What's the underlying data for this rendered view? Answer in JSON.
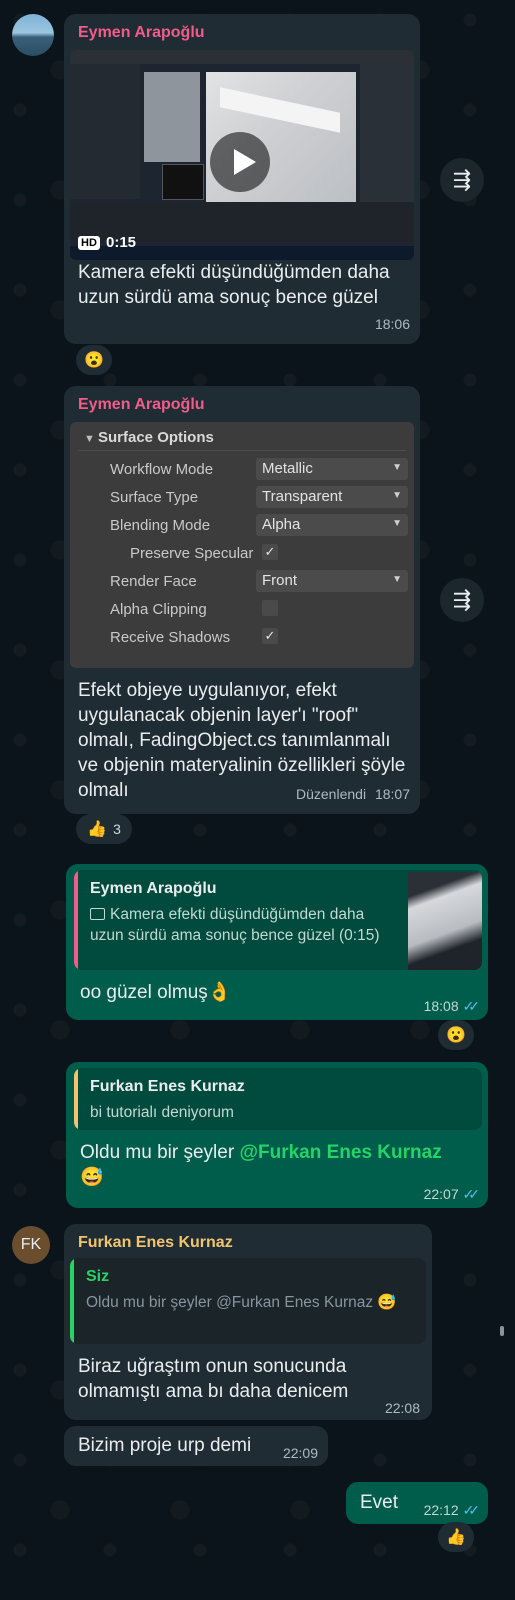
{
  "messages": {
    "m1": {
      "sender": "Eymen Arapoğlu",
      "video_quality": "HD",
      "video_duration": "0:15",
      "text": "Kamera efekti düşündüğümden daha uzun sürdü ama sonuç bence güzel",
      "time": "18:06",
      "reaction": "😮"
    },
    "m2": {
      "sender": "Eymen Arapoğlu",
      "panel_title": "Surface Options",
      "rows": [
        {
          "label": "Workflow Mode",
          "value": "Metallic"
        },
        {
          "label": "Surface Type",
          "value": "Transparent"
        },
        {
          "label": "Blending Mode",
          "value": "Alpha"
        },
        {
          "label": "Preserve Specular",
          "value": ""
        },
        {
          "label": "Render Face",
          "value": "Front"
        },
        {
          "label": "Alpha Clipping",
          "value": ""
        },
        {
          "label": "Receive Shadows",
          "value": ""
        }
      ],
      "checks": [
        "✓",
        "",
        "✓"
      ],
      "text": "Efekt objeye uygulanıyor, efekt uygulanacak objenin layer'ı \"roof\" olmalı, FadingObject.cs tanımlanmalı ve objenin materyalinin özellikleri şöyle olmalı",
      "edited": "Düzenlendi",
      "time": "18:07",
      "reaction_emoji": "👍",
      "reaction_count": "3"
    },
    "m3": {
      "quote_sender": "Eymen Arapoğlu",
      "quote_icon": "video-icon",
      "quote_text": "Kamera efekti düşündüğümden daha uzun sürdü ama sonuç bence güzel (0:15)",
      "text": "oo güzel olmuş👌",
      "time": "18:08",
      "reaction": "😮"
    },
    "m4": {
      "quote_sender": "Furkan Enes Kurnaz",
      "quote_text": "bi tutorialı deniyorum",
      "text_prefix": "Oldu mu bir şeyler ",
      "mention": "@Furkan Enes Kurnaz",
      "emoji": "😅",
      "time": "22:07"
    },
    "m5": {
      "avatar": "FK",
      "sender": "Furkan Enes Kurnaz",
      "quote_sender": "Siz",
      "quote_text": "Oldu mu bir şeyler @Furkan Enes Kurnaz 😅",
      "text": "Biraz uğraştım onun sonucunda olmamıştı ama bı daha denicem",
      "time": "22:08"
    },
    "m6": {
      "text": "Bizim proje urp demi",
      "time": "22:09"
    },
    "m7": {
      "text": "Evet",
      "time": "22:12",
      "reaction": "👍"
    }
  },
  "icons": {
    "forward": "forward-icon",
    "play": "play-icon",
    "ticks": "double-check-icon"
  },
  "colors": {
    "background": "#0b141a",
    "bubble_in": "#202c33",
    "bubble_out": "#005c4b",
    "sender_pink": "#f15c8a",
    "sender_yellow": "#f2c46f",
    "mention": "#25d366",
    "read_ticks": "#53bdeb",
    "avatar_bg": "#6b4e2e"
  }
}
